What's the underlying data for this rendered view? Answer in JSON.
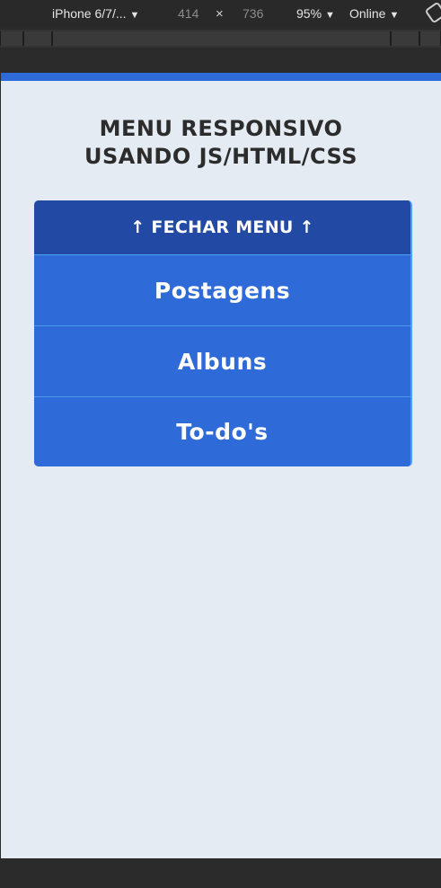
{
  "devtools": {
    "device": "iPhone 6/7/...",
    "width": "414",
    "times": "×",
    "height": "736",
    "zoom": "95%",
    "network": "Online",
    "caret": "▼"
  },
  "page": {
    "title_line1": "MENU RESPONSIVO",
    "title_line2": "USANDO JS/HTML/CSS",
    "close_menu": "↑ FECHAR MENU ↑",
    "items": [
      {
        "label": "Postagens"
      },
      {
        "label": "Albuns"
      },
      {
        "label": "To-do's"
      }
    ]
  },
  "colors": {
    "accent": "#2f6bd8",
    "close_bg": "#2249a3",
    "page_bg": "#e4ebf2"
  }
}
